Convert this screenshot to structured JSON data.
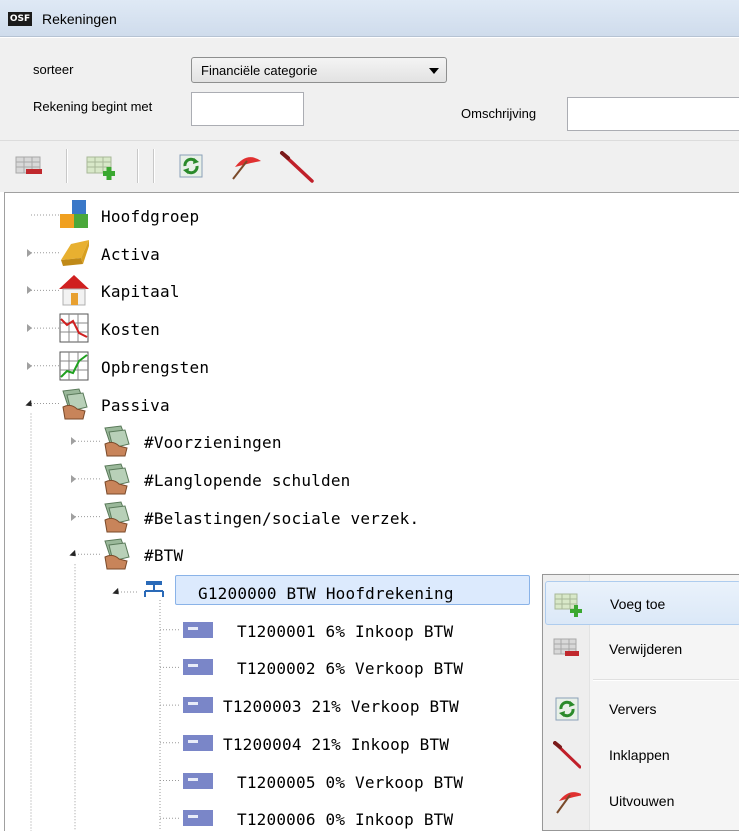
{
  "window": {
    "app_badge": "OSF",
    "title": "Rekeningen"
  },
  "filter": {
    "sort_label": "sorteer",
    "sort_value": "Financiële categorie",
    "starts_with_label": "Rekening begint met",
    "starts_with_value": "",
    "description_label": "Omschrijving",
    "description_value": ""
  },
  "toolbar": {
    "buttons": [
      "delete-account",
      "add-account",
      "refresh",
      "expand-all",
      "collapse-all"
    ]
  },
  "tree": {
    "nodes": [
      {
        "label": "Hoofdgroep",
        "icon": "blocks-icon",
        "level": 0,
        "state": "leaf"
      },
      {
        "label": "Activa",
        "icon": "gold-bar-icon",
        "level": 0,
        "state": "collapsed"
      },
      {
        "label": "Kapitaal",
        "icon": "house-icon",
        "level": 0,
        "state": "collapsed"
      },
      {
        "label": "Kosten",
        "icon": "falling-chart-icon",
        "level": 0,
        "state": "collapsed"
      },
      {
        "label": "Opbrengsten",
        "icon": "rising-chart-icon",
        "level": 0,
        "state": "collapsed"
      },
      {
        "label": "Passiva",
        "icon": "money-hand-icon",
        "level": 0,
        "state": "expanded"
      },
      {
        "label": "#Voorzieningen",
        "icon": "money-hand-icon",
        "level": 1,
        "state": "collapsed"
      },
      {
        "label": "#Langlopende schulden",
        "icon": "money-hand-icon",
        "level": 1,
        "state": "collapsed"
      },
      {
        "label": "#Belastingen/sociale verzek.",
        "icon": "money-hand-icon",
        "level": 1,
        "state": "collapsed"
      },
      {
        "label": "#BTW",
        "icon": "money-hand-icon",
        "level": 1,
        "state": "expanded"
      },
      {
        "label": "G1200000 BTW Hoofdrekening",
        "icon": "hierarchy-icon",
        "level": 2,
        "state": "expanded",
        "selected": true
      },
      {
        "label": "T1200001 6% Inkoop BTW",
        "icon": "account-card-icon",
        "level": 3,
        "state": "leaf"
      },
      {
        "label": "T1200002 6% Verkoop BTW",
        "icon": "account-card-icon",
        "level": 3,
        "state": "leaf"
      },
      {
        "label": "T1200003 21% Verkoop BTW",
        "icon": "account-card-icon",
        "level": 3,
        "state": "leaf"
      },
      {
        "label": "T1200004 21% Inkoop BTW",
        "icon": "account-card-icon",
        "level": 3,
        "state": "leaf"
      },
      {
        "label": "T1200005 0% Verkoop BTW",
        "icon": "account-card-icon",
        "level": 3,
        "state": "leaf"
      },
      {
        "label": "T1200006 0% Inkoop BTW",
        "icon": "account-card-icon",
        "level": 3,
        "state": "leaf"
      }
    ]
  },
  "context_menu": {
    "items": [
      {
        "label": "Voeg toe",
        "icon": "add-account-icon",
        "highlighted": true
      },
      {
        "label": "Verwijderen",
        "icon": "delete-account-icon"
      },
      {
        "label": "Ververs",
        "icon": "refresh-icon"
      },
      {
        "label": "Inklappen",
        "icon": "collapse-icon"
      },
      {
        "label": "Uitvouwen",
        "icon": "umbrella-icon"
      }
    ]
  },
  "colors": {
    "selection_bg": "#dceafd",
    "selection_border": "#8ab3e8",
    "window_bg": "#f0f0f0",
    "titlebar": "#dfe9f5"
  }
}
